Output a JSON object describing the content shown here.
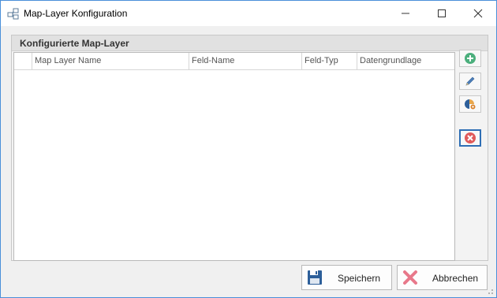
{
  "window": {
    "title": "Map-Layer Konfiguration",
    "app_icon": "network-icon",
    "controls": {
      "minimize": "minimize-icon",
      "maximize": "maximize-icon",
      "close": "close-icon"
    }
  },
  "panel": {
    "title": "Konfigurierte Map-Layer",
    "columns": [
      "Map Layer Name",
      "Feld-Name",
      "Feld-Typ",
      "Datengrundlage"
    ],
    "rows": []
  },
  "side_buttons": {
    "add": "add-icon",
    "edit": "pencil-icon",
    "configure": "palette-gear-icon",
    "delete": "delete-icon"
  },
  "footer": {
    "save_label": "Speichern",
    "cancel_label": "Abbrechen"
  },
  "colors": {
    "window_border": "#4a90d9",
    "add_green": "#4caf7d",
    "delete_red": "#e05a5a",
    "save_blue": "#2d5f9a",
    "cancel_pink": "#e8788a"
  }
}
